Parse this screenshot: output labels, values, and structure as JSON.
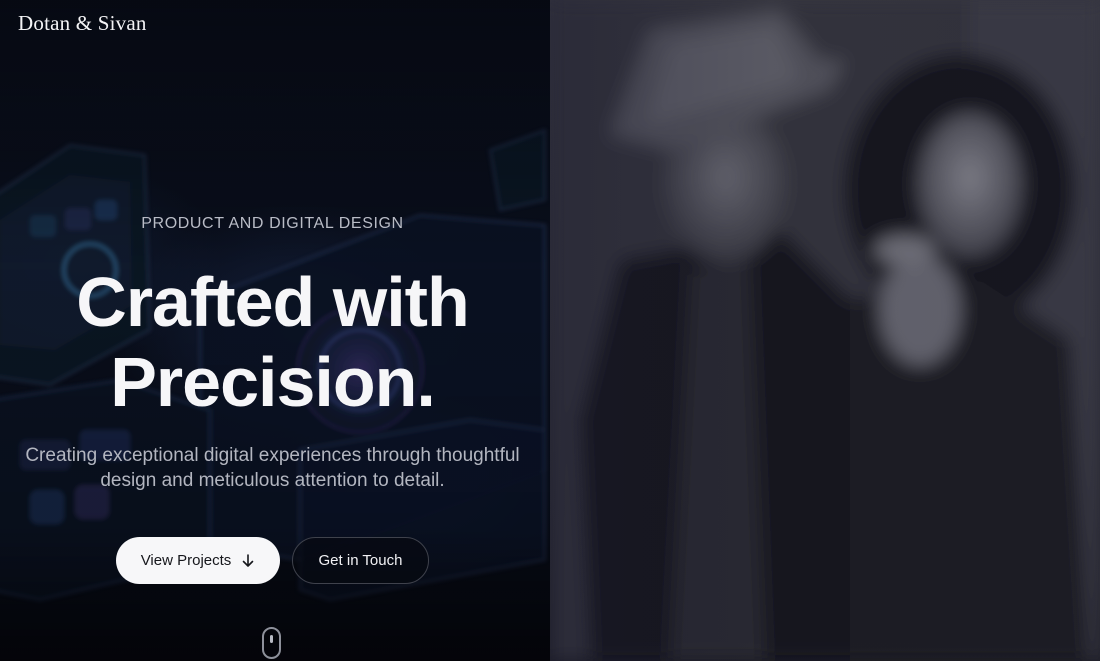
{
  "brand": {
    "name": "Dotan & Sivan"
  },
  "hero": {
    "eyebrow": "PRODUCT AND DIGITAL DESIGN",
    "headline": [
      "Crafted with",
      "Precision."
    ],
    "subtext": [
      "Creating exceptional digital experiences through thoughtful",
      "design and meticulous attention to detail."
    ],
    "primary_button": {
      "label": "View Projects",
      "icon": "arrow-down-icon"
    },
    "secondary_button": {
      "label": "Get in Touch"
    },
    "scroll_indicator": {
      "icon": "mouse-icon"
    }
  },
  "colors": {
    "background": "#06070d",
    "primary_button_bg": "#f7f7f9",
    "headline": "#f6f6f8",
    "muted_text": "#b3b6c0"
  }
}
